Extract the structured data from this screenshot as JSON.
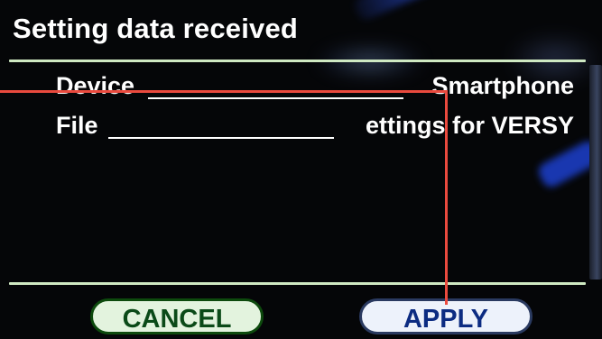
{
  "dialog": {
    "title": "Setting data received"
  },
  "rows": [
    {
      "label": "Device",
      "value": "Smartphone"
    },
    {
      "label": "File",
      "value": "ettings for VERSY"
    }
  ],
  "buttons": {
    "cancel": "CANCEL",
    "apply": "APPLY"
  },
  "colors": {
    "annotation": "#ea4a3e",
    "divider": "#cfe9c2",
    "cancel_button_bg": "#e3f3de",
    "apply_button_bg": "#edf2fb"
  }
}
